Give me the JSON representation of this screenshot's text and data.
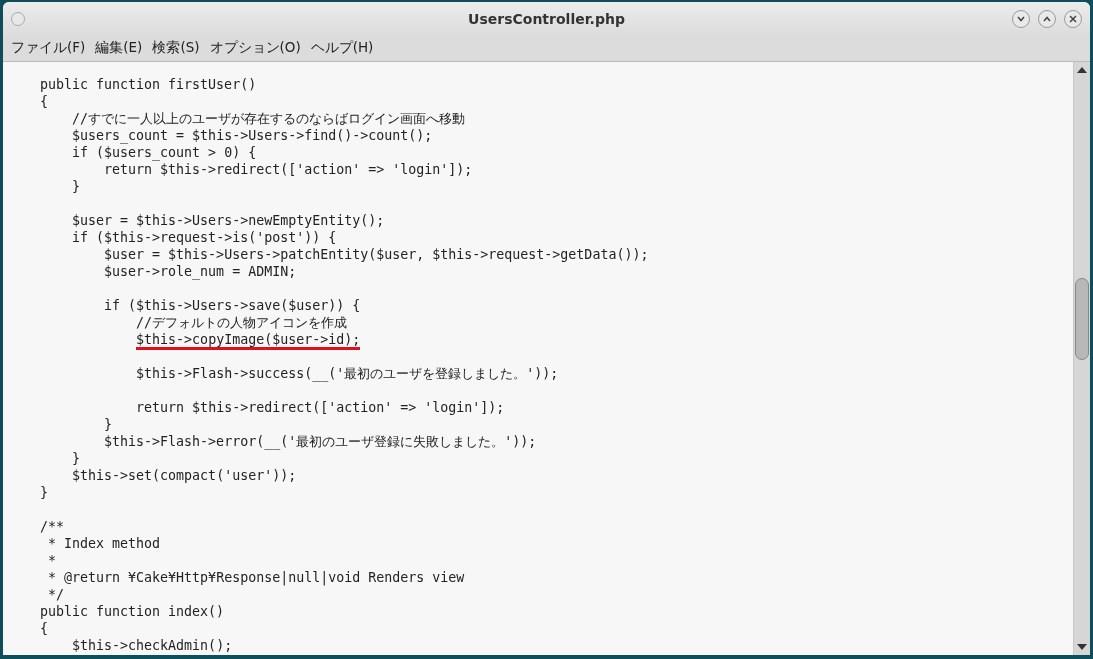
{
  "window": {
    "title": "UsersController.php"
  },
  "menu": [
    {
      "label": "ファイル(F)"
    },
    {
      "label": "編集(E)"
    },
    {
      "label": "検索(S)"
    },
    {
      "label": "オプション(O)"
    },
    {
      "label": "ヘルプ(H)"
    }
  ],
  "code_lines": [
    {
      "kind": "code",
      "text": "public function firstUser()"
    },
    {
      "kind": "code",
      "text": "{"
    },
    {
      "kind": "code",
      "text": "    //すでに一人以上のユーザが存在するのならばログイン画面へ移動"
    },
    {
      "kind": "code",
      "text": "    $users_count = $this->Users->find()->count();"
    },
    {
      "kind": "code",
      "text": "    if ($users_count > 0) {"
    },
    {
      "kind": "code",
      "text": "        return $this->redirect(['action' => 'login']);"
    },
    {
      "kind": "code",
      "text": "    }"
    },
    {
      "kind": "blank"
    },
    {
      "kind": "code",
      "text": "    $user = $this->Users->newEmptyEntity();"
    },
    {
      "kind": "code",
      "text": "    if ($this->request->is('post')) {"
    },
    {
      "kind": "code",
      "text": "        $user = $this->Users->patchEntity($user, $this->request->getData());"
    },
    {
      "kind": "code",
      "text": "        $user->role_num = ADMIN;"
    },
    {
      "kind": "blank"
    },
    {
      "kind": "code",
      "text": "        if ($this->Users->save($user)) {"
    },
    {
      "kind": "code",
      "text": "            //デフォルトの人物アイコンを作成"
    },
    {
      "kind": "underlined",
      "text": "            $this->copyImage($user->id);"
    },
    {
      "kind": "blank"
    },
    {
      "kind": "code",
      "text": "            $this->Flash->success(__('最初のユーザを登録しました。'));"
    },
    {
      "kind": "blank"
    },
    {
      "kind": "code",
      "text": "            return $this->redirect(['action' => 'login']);"
    },
    {
      "kind": "code",
      "text": "        }"
    },
    {
      "kind": "code",
      "text": "        $this->Flash->error(__('最初のユーザ登録に失敗しました。'));"
    },
    {
      "kind": "code",
      "text": "    }"
    },
    {
      "kind": "code",
      "text": "    $this->set(compact('user'));"
    },
    {
      "kind": "code",
      "text": "}"
    },
    {
      "kind": "blank"
    },
    {
      "kind": "code",
      "text": "/**"
    },
    {
      "kind": "code",
      "text": " * Index method"
    },
    {
      "kind": "code",
      "text": " *"
    },
    {
      "kind": "code",
      "text": " * @return ¥Cake¥Http¥Response|null|void Renders view"
    },
    {
      "kind": "code",
      "text": " */"
    },
    {
      "kind": "code",
      "text": "public function index()"
    },
    {
      "kind": "code",
      "text": "{"
    },
    {
      "kind": "code",
      "text": "    $this->checkAdmin();"
    }
  ]
}
